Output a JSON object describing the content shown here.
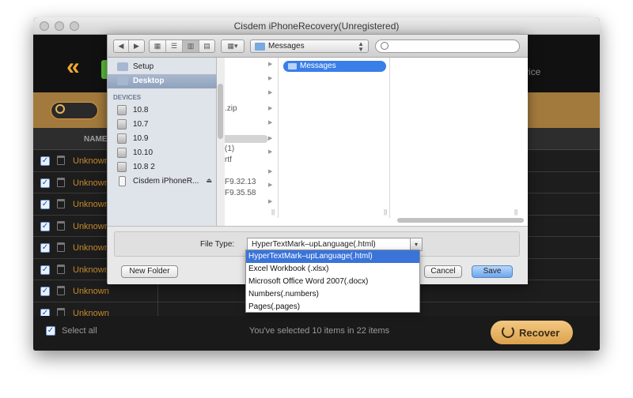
{
  "window": {
    "title": "Cisdem iPhoneRecovery(Unregistered)",
    "partial_label": "vice"
  },
  "table": {
    "name_header": "NAME",
    "rows": [
      "Unknown",
      "Unknown",
      "Unknown",
      "Unknown",
      "Unknown",
      "Unknown",
      "Unknown",
      "Unknown"
    ]
  },
  "footer": {
    "select_all": "Select all",
    "selected_info": "You've selected 10 items in 22 items",
    "recover": "Recover"
  },
  "save_dialog": {
    "location_popup": "Messages",
    "sidebar": {
      "favorites": [
        {
          "label": "Setup"
        },
        {
          "label": "Desktop"
        }
      ],
      "devices_header": "DEVICES",
      "devices": [
        "10.8",
        "10.7",
        "10.9",
        "10.10",
        "10.8 2",
        "Cisdem iPhoneR..."
      ]
    },
    "column1_entries": [
      ".zip",
      "(1)",
      "rtf",
      "F9.32.13",
      "F9.35.58"
    ],
    "column2_selected": "Messages",
    "file_type_label": "File Type:",
    "file_type_value": "HyperTextMark–upLanguage(.html)",
    "new_folder": "New Folder",
    "cancel": "Cancel",
    "save": "Save",
    "file_type_options": [
      "HyperTextMark–upLanguage(.html)",
      "Excel Workbook (.xlsx)",
      "Microsoft Office Word 2007(.docx)",
      "Numbers(.numbers)",
      "Pages(.pages)"
    ]
  },
  "colors": {
    "accent": "#f0a830",
    "search_bar": "#a37a3d",
    "selection": "#3a74d9"
  }
}
